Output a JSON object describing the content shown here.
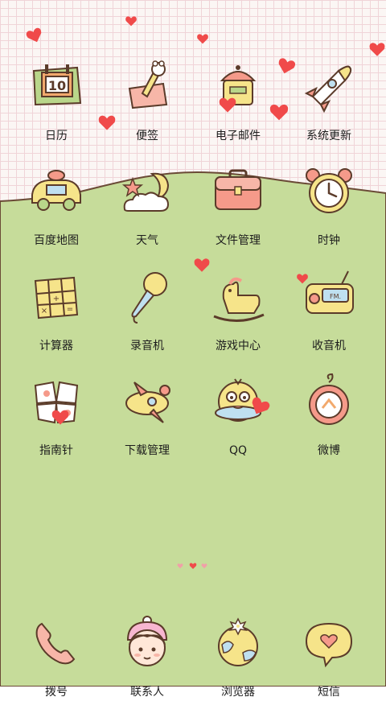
{
  "apps": [
    {
      "label": "日历",
      "icon": "calendar-icon"
    },
    {
      "label": "便签",
      "icon": "notepad-icon"
    },
    {
      "label": "电子邮件",
      "icon": "mailbox-icon"
    },
    {
      "label": "系统更新",
      "icon": "rocket-icon"
    },
    {
      "label": "百度地图",
      "icon": "car-icon"
    },
    {
      "label": "天气",
      "icon": "moon-cloud-icon"
    },
    {
      "label": "文件管理",
      "icon": "briefcase-icon"
    },
    {
      "label": "时钟",
      "icon": "alarm-clock-icon"
    },
    {
      "label": "计算器",
      "icon": "calculator-icon"
    },
    {
      "label": "录音机",
      "icon": "microphone-icon"
    },
    {
      "label": "游戏中心",
      "icon": "rocking-horse-icon"
    },
    {
      "label": "收音机",
      "icon": "radio-icon"
    },
    {
      "label": "指南针",
      "icon": "compass-icon"
    },
    {
      "label": "下载管理",
      "icon": "plane-icon"
    },
    {
      "label": "QQ",
      "icon": "qq-penguin-icon"
    },
    {
      "label": "微博",
      "icon": "weibo-icon"
    }
  ],
  "dock": [
    {
      "label": "拨号",
      "icon": "phone-icon"
    },
    {
      "label": "联系人",
      "icon": "contact-girl-icon"
    },
    {
      "label": "浏览器",
      "icon": "globe-icon"
    },
    {
      "label": "短信",
      "icon": "message-heart-icon"
    }
  ],
  "pager": {
    "pages": 3,
    "current": 1
  },
  "colors": {
    "grass": "#c6dc9a",
    "paper": "#fbf6f4",
    "grid": "#f0d4d8",
    "heart": "#f04a4a",
    "outline": "#5b3b2a"
  }
}
